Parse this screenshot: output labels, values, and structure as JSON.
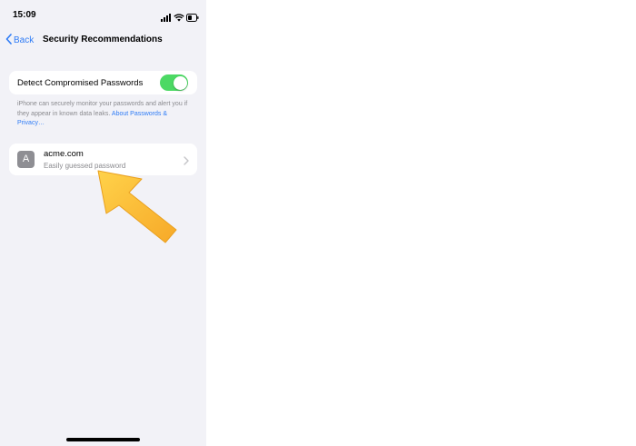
{
  "status_bar": {
    "time": "15:09",
    "icons": [
      "signal-icon",
      "wifi-icon",
      "battery-icon"
    ]
  },
  "nav": {
    "back_label": "Back",
    "title": "Security Recommendations"
  },
  "settings": {
    "detect_label": "Detect Compromised Passwords",
    "detect_enabled": true,
    "footnote_text": "iPhone can securely monitor your passwords and alert you if they appear in known data leaks. ",
    "footnote_link": "About Passwords & Privacy…"
  },
  "recommendations": [
    {
      "avatar_letter": "A",
      "title": "acme.com",
      "subtitle": "Easily guessed password"
    }
  ],
  "colors": {
    "background": "#f2f2f7",
    "accent": "#2f7cf6",
    "toggle_on": "#4cd964",
    "annotation_arrow": "#fbb034"
  }
}
